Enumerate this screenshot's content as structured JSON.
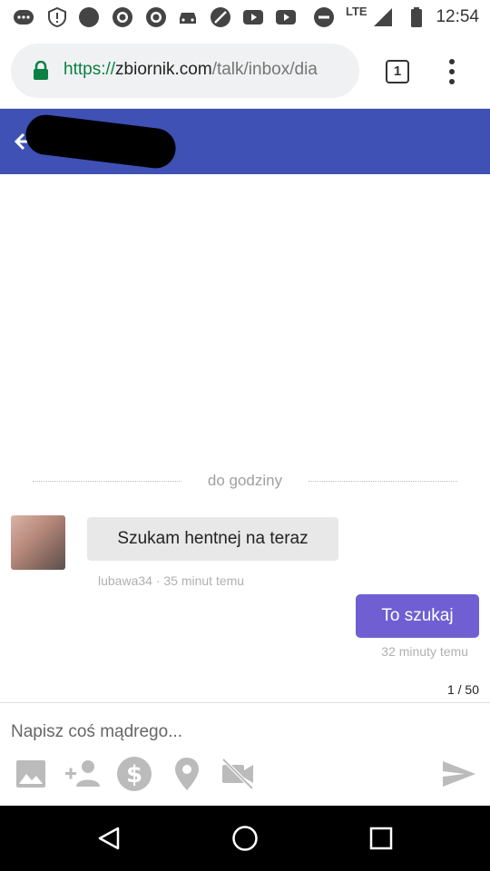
{
  "status_bar": {
    "time": "12:54",
    "network": "LTE"
  },
  "browser": {
    "url_scheme": "https://",
    "url_host": "zbiornik.com",
    "url_path": "/talk/inbox/dia",
    "tab_count": "1"
  },
  "chat": {
    "divider_label": "do godziny",
    "messages": [
      {
        "text": "Szukam hentnej na teraz",
        "meta": "lubawa34 · 35 minut temu"
      },
      {
        "text": "To szukaj",
        "meta": "32 minuty temu"
      }
    ],
    "char_count": "1 / 50"
  },
  "composer": {
    "placeholder": "Napisz coś mądrego..."
  },
  "colors": {
    "header": "#3f51b5",
    "outgoing_bubble": "#6f5fd3",
    "incoming_bubble": "#e8e8e8"
  }
}
